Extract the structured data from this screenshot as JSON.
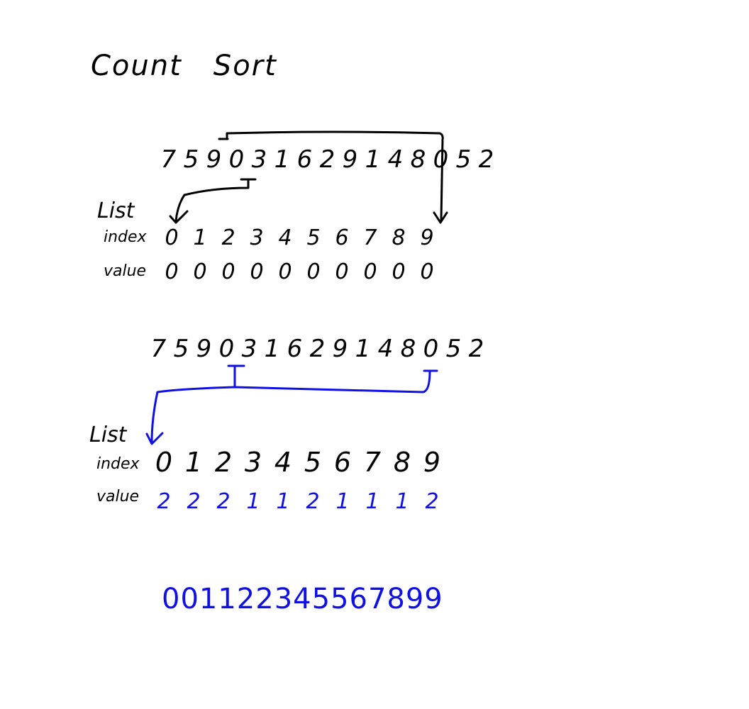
{
  "title": {
    "word1": "Count",
    "word2": "Sort"
  },
  "step1": {
    "input_sequence": [
      "7",
      "5",
      "9",
      "0",
      "3",
      "1",
      "6",
      "2",
      "9",
      "1",
      "4",
      "8",
      "0",
      "5",
      "2"
    ],
    "list_label": "List",
    "index_label": "index",
    "value_label": "value",
    "indices": [
      "0",
      "1",
      "2",
      "3",
      "4",
      "5",
      "6",
      "7",
      "8",
      "9"
    ],
    "values": [
      "0",
      "0",
      "0",
      "0",
      "0",
      "0",
      "0",
      "0",
      "0",
      "0"
    ]
  },
  "step2": {
    "input_sequence": [
      "7",
      "5",
      "9",
      "0",
      "3",
      "1",
      "6",
      "2",
      "9",
      "1",
      "4",
      "8",
      "0",
      "5",
      "2"
    ],
    "list_label": "List",
    "index_label": "index",
    "value_label": "value",
    "indices": [
      "0",
      "1",
      "2",
      "3",
      "4",
      "5",
      "6",
      "7",
      "8",
      "9"
    ],
    "values": [
      "2",
      "2",
      "2",
      "1",
      "1",
      "2",
      "1",
      "1",
      "1",
      "2"
    ]
  },
  "result": {
    "sorted": "001122345567899"
  },
  "colors": {
    "ink": "#000000",
    "highlight": "#1010e6",
    "background": "#ffffff"
  }
}
